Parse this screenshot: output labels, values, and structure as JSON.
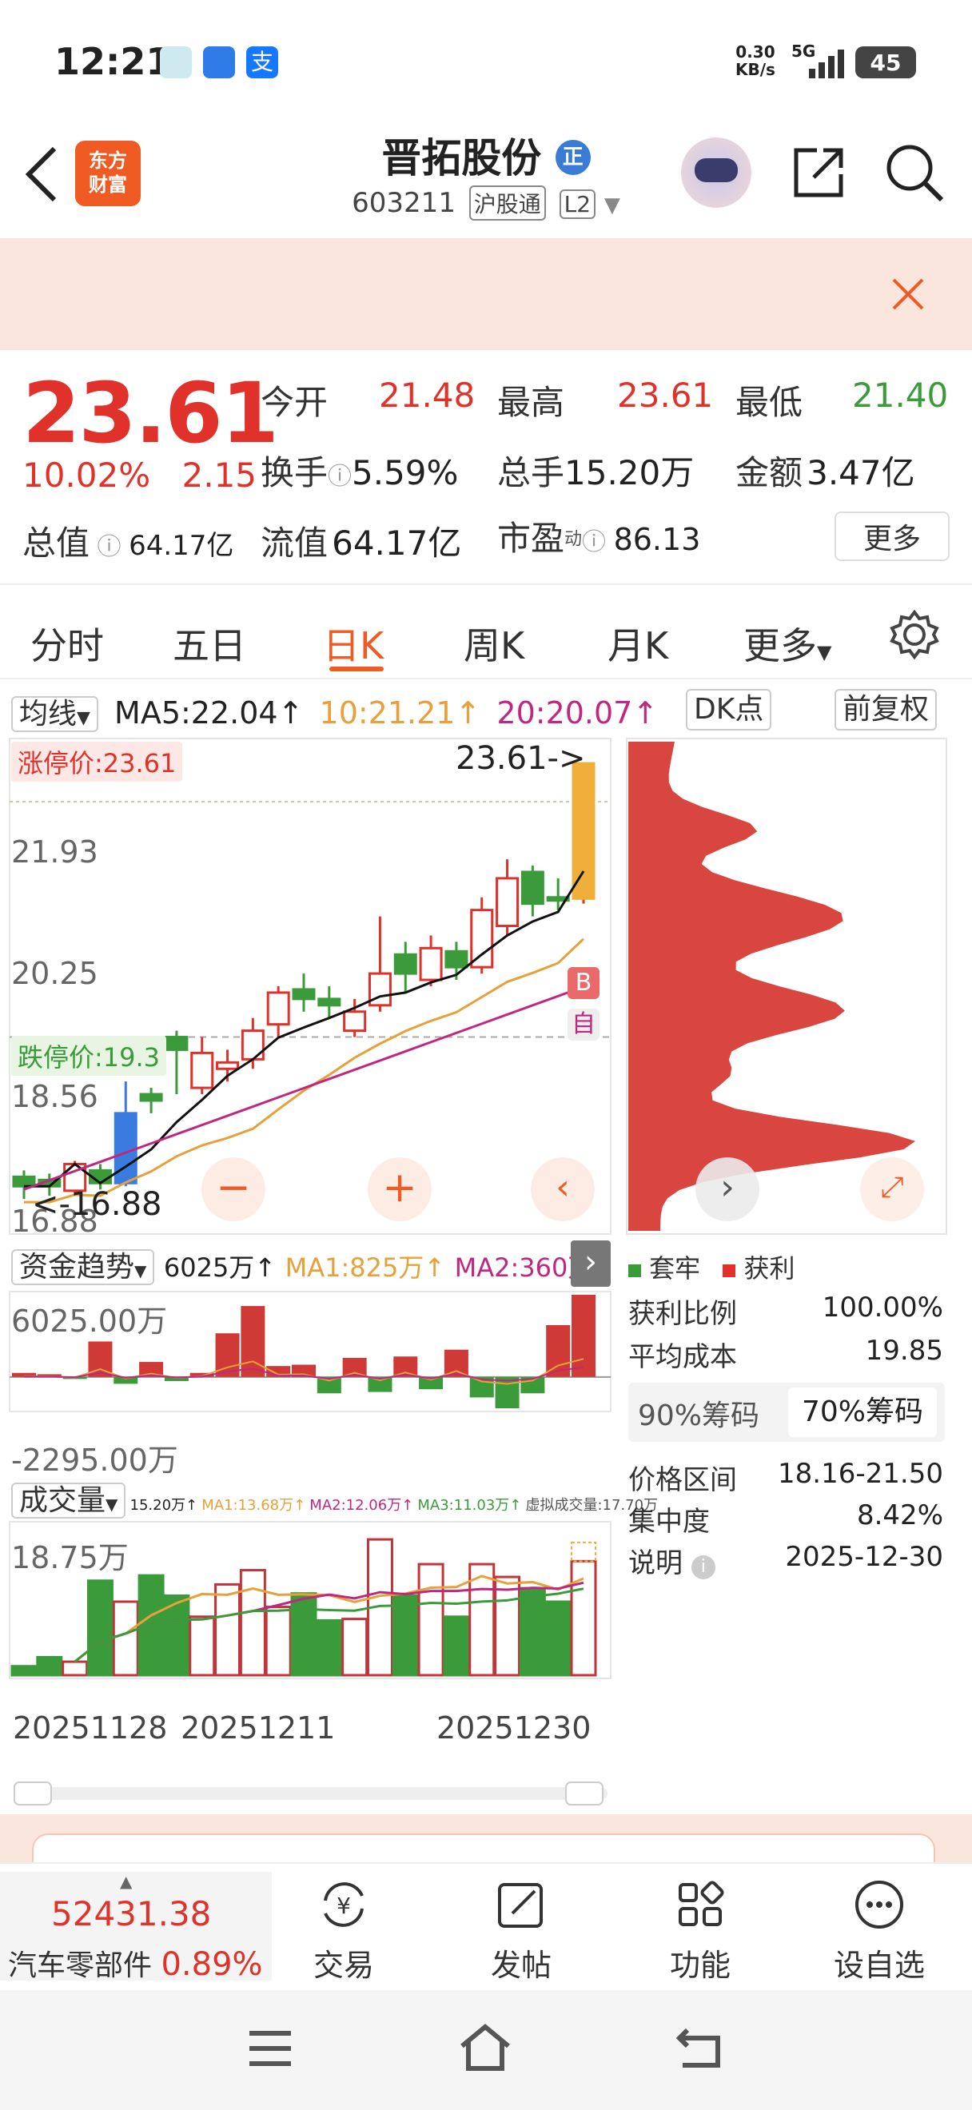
{
  "status_bar": {
    "time": "12:21",
    "net_speed": "0.30",
    "net_unit": "KB/s",
    "signal": "5G",
    "battery": "45"
  },
  "header": {
    "logo_text": "东方财富",
    "stock_name": "晋拓股份",
    "badge": "正",
    "stock_code": "603211",
    "connect_tag": "沪股通",
    "level_tag": "L2"
  },
  "quote": {
    "price": "23.61",
    "change_pct": "10.02%",
    "change_amt": "2.15",
    "open_label": "今开",
    "open": "21.48",
    "high_label": "最高",
    "high": "23.61",
    "low_label": "最低",
    "low": "21.40",
    "turnover_label": "换手",
    "turnover": "5.59%",
    "volume_label": "总手",
    "volume": "15.20万",
    "amount_label": "金额",
    "amount": "3.47亿",
    "mktcap_label": "总值",
    "mktcap": "64.17亿",
    "float_label": "流值",
    "float": "64.17亿",
    "pe_label": "市盈",
    "pe_sup": "动",
    "pe": "86.13",
    "more": "更多"
  },
  "period_tabs": [
    "分时",
    "五日",
    "日K",
    "周K",
    "月K",
    "更多"
  ],
  "active_tab": "日K",
  "ma_row": {
    "selector": "均线",
    "ma5": "MA5:22.04↑",
    "ma10": "10:21.21↑",
    "ma20": "20:20.07↑",
    "dk": "DK点",
    "adjust": "前复权"
  },
  "kline": {
    "limit_up_label": "涨停价:23.61",
    "limit_down_label": "跌停价:19.3",
    "price_marker": "23.61->",
    "low_marker": "<-16.88",
    "axis": [
      "21.93",
      "20.25",
      "18.56",
      "16.88"
    ],
    "buy_badge": "B",
    "auto_badge": "自",
    "candles": [
      {
        "o": 17.1,
        "c": 16.95,
        "h": 17.2,
        "l": 16.75
      },
      {
        "o": 17.05,
        "c": 16.95,
        "h": 17.15,
        "l": 16.8
      },
      {
        "o": 16.88,
        "c": 17.3,
        "h": 17.35,
        "l": 16.85
      },
      {
        "o": 17.2,
        "c": 17.0,
        "h": 17.3,
        "l": 16.9
      },
      {
        "o": 17.0,
        "c": 18.1,
        "h": 18.6,
        "l": 16.95
      },
      {
        "o": 18.4,
        "c": 18.3,
        "h": 18.5,
        "l": 18.1
      },
      {
        "o": 19.3,
        "c": 19.1,
        "h": 19.4,
        "l": 18.4
      },
      {
        "o": 18.5,
        "c": 19.05,
        "h": 19.3,
        "l": 18.4
      },
      {
        "o": 18.8,
        "c": 18.9,
        "h": 19.1,
        "l": 18.6
      },
      {
        "o": 18.95,
        "c": 19.4,
        "h": 19.6,
        "l": 18.8
      },
      {
        "o": 19.5,
        "c": 20.0,
        "h": 20.1,
        "l": 19.3
      },
      {
        "o": 20.05,
        "c": 19.9,
        "h": 20.3,
        "l": 19.7
      },
      {
        "o": 19.9,
        "c": 19.8,
        "h": 20.1,
        "l": 19.6
      },
      {
        "o": 19.4,
        "c": 19.7,
        "h": 19.9,
        "l": 19.3
      },
      {
        "o": 19.8,
        "c": 20.3,
        "h": 21.2,
        "l": 19.7
      },
      {
        "o": 20.6,
        "c": 20.3,
        "h": 20.8,
        "l": 20.0
      },
      {
        "o": 20.2,
        "c": 20.7,
        "h": 20.9,
        "l": 20.1
      },
      {
        "o": 20.65,
        "c": 20.4,
        "h": 20.8,
        "l": 20.2
      },
      {
        "o": 20.4,
        "c": 21.3,
        "h": 21.5,
        "l": 20.3
      },
      {
        "o": 21.05,
        "c": 21.8,
        "h": 22.1,
        "l": 20.9
      },
      {
        "o": 21.9,
        "c": 21.4,
        "h": 22.0,
        "l": 21.2
      },
      {
        "o": 21.5,
        "c": 21.45,
        "h": 21.8,
        "l": 21.3
      },
      {
        "o": 21.48,
        "c": 23.61,
        "h": 23.61,
        "l": 21.4
      }
    ]
  },
  "fund_flow": {
    "selector": "资金趋势",
    "value": "6025万↑",
    "ma1": "MA1:825万↑",
    "ma2": "MA2:360万↑",
    "max_label": "6025.00万",
    "min_label": "-2295.00万",
    "bars": [
      300,
      200,
      -150,
      2600,
      -500,
      1100,
      -300,
      300,
      3200,
      5200,
      800,
      900,
      -1200,
      1400,
      -1100,
      1500,
      -900,
      2000,
      -1500,
      -2295,
      -1200,
      3800,
      6025
    ]
  },
  "volume": {
    "selector": "成交量",
    "value": "15.20万↑",
    "ma1": "MA1:13.68万↑",
    "ma2": "MA2:12.06万↑",
    "ma3": "MA3:11.03万↑",
    "virtual": "虚拟成交量:17.70万",
    "max_label": "18.75万",
    "bars": [
      1.2,
      2.4,
      1.8,
      12.6,
      9.8,
      13.3,
      10.6,
      7.8,
      12.1,
      14.0,
      9.1,
      10.9,
      7.3,
      7.5,
      18.1,
      10.6,
      14.8,
      7.8,
      14.8,
      13.1,
      11.6,
      9.8,
      15.2
    ]
  },
  "dates": [
    "20251128",
    "20251211",
    "20251230"
  ],
  "chip": {
    "legend_trapped": "套牢",
    "legend_profit": "获利",
    "profit_ratio_label": "获利比例",
    "profit_ratio": "100.00%",
    "avg_cost_label": "平均成本",
    "avg_cost": "19.85",
    "tab90": "90%筹码",
    "tab70": "70%筹码",
    "range_label": "价格区间",
    "range": "18.16-21.50",
    "concentration_label": "集中度",
    "concentration": "8.42%",
    "note_label": "说明",
    "note": "2025-12-30"
  },
  "bottom_nav": {
    "index_value": "52431.38",
    "sector": "汽车零部件",
    "sector_pct": "0.89%",
    "trade": "交易",
    "post": "发帖",
    "func": "功能",
    "watch": "设自选"
  },
  "colors": {
    "up": "#e0322a",
    "down": "#3b9b3b",
    "accent": "#f05a23"
  }
}
